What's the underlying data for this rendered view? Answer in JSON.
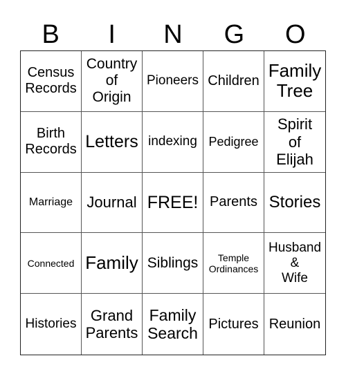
{
  "header": {
    "letters": [
      "B",
      "I",
      "N",
      "G",
      "O"
    ]
  },
  "card": {
    "rows": [
      [
        "Census\nRecords",
        "Country\nof\nOrigin",
        "Pioneers",
        "Children",
        "Family\nTree"
      ],
      [
        "Birth\nRecords",
        "Letters",
        "indexing",
        "Pedigree",
        "Spirit\nof\nElijah"
      ],
      [
        "Marriage",
        "Journal",
        "FREE!",
        "Parents",
        "Stories"
      ],
      [
        "Connected",
        "Family",
        "Siblings",
        "Temple\nOrdinances",
        "Husband\n&\nWife"
      ],
      [
        "Histories",
        "Grand\nParents",
        "Family\nSearch",
        "Pictures",
        "Reunion"
      ]
    ]
  }
}
